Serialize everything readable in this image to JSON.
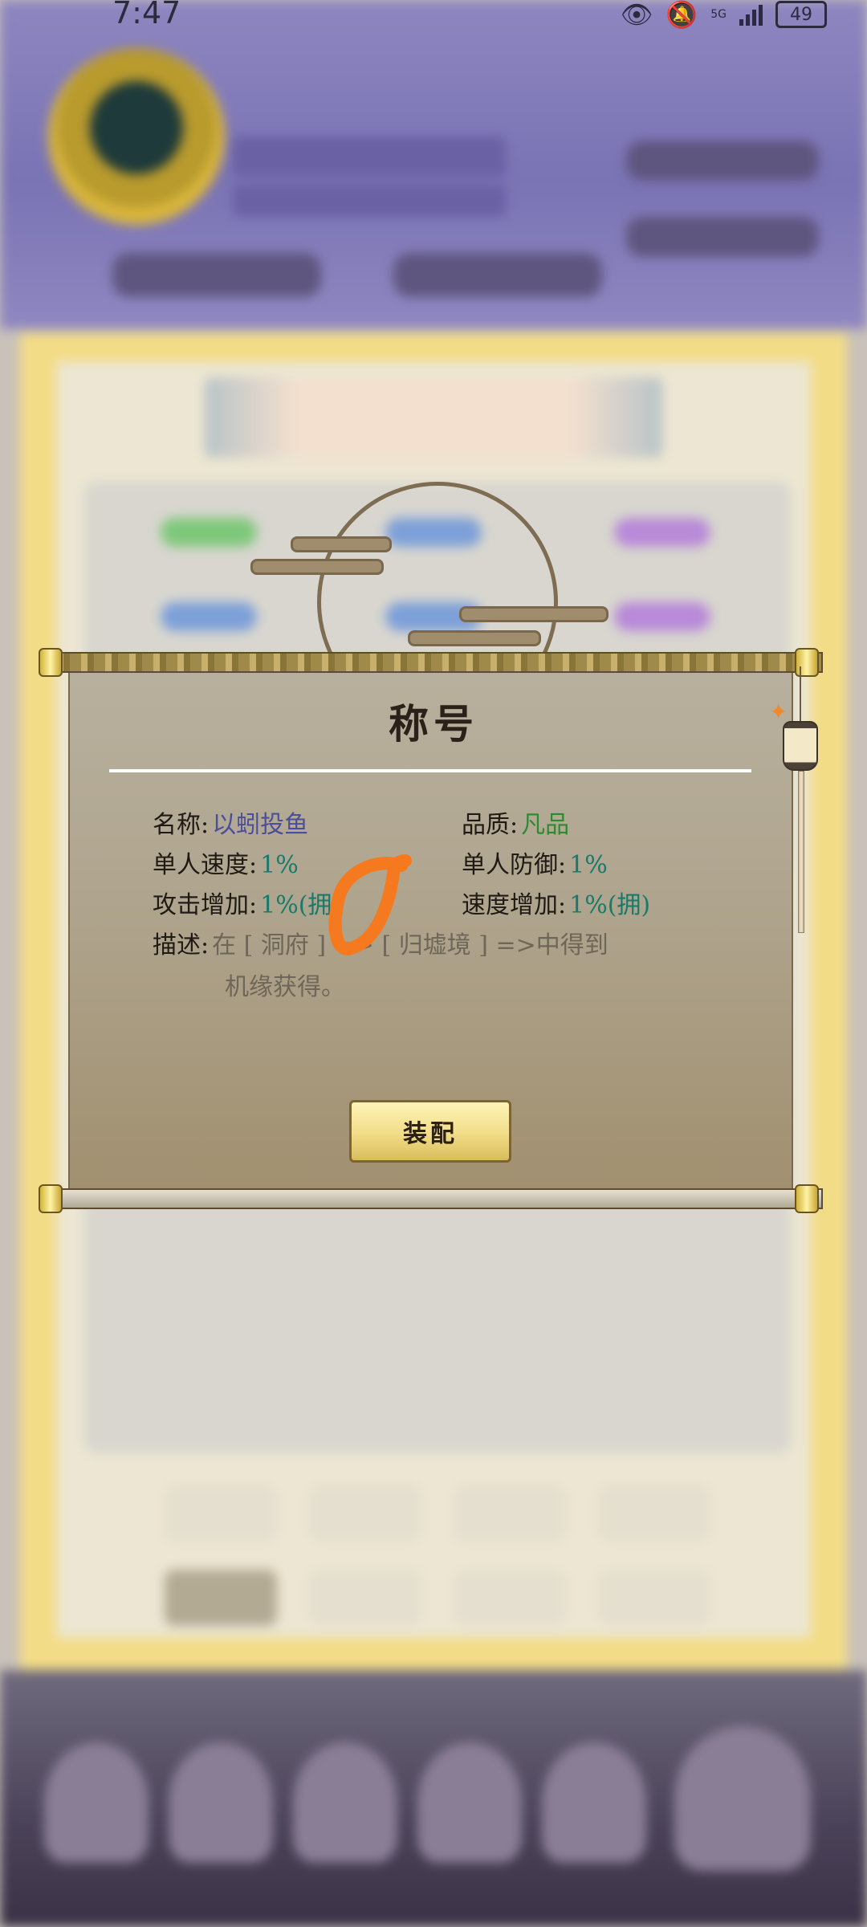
{
  "status_bar": {
    "time": "7:47",
    "network": "5G",
    "battery": "49"
  },
  "dialog": {
    "title": "称号",
    "name_label": "名称:",
    "name_value": "以蚓投鱼",
    "quality_label": "品质:",
    "quality_value": "凡品",
    "single_speed_label": "单人速度:",
    "single_speed_value": "1%",
    "single_defense_label": "单人防御:",
    "single_defense_value": "1%",
    "attack_bonus_label": "攻击增加:",
    "attack_bonus_value": "1%(拥)",
    "speed_bonus_label": "速度增加:",
    "speed_bonus_value": "1%(拥)",
    "desc_label": "描述:",
    "desc_line1": "在 [ 洞府 ] => [ 归墟境 ] =>中得到",
    "desc_line2": "机缘获得。",
    "equip_button": "装配"
  },
  "colors": {
    "name": "#4b4e9a",
    "quality": "#2e8a2e",
    "value": "#177a6a",
    "annotation": "#f57a1f"
  }
}
